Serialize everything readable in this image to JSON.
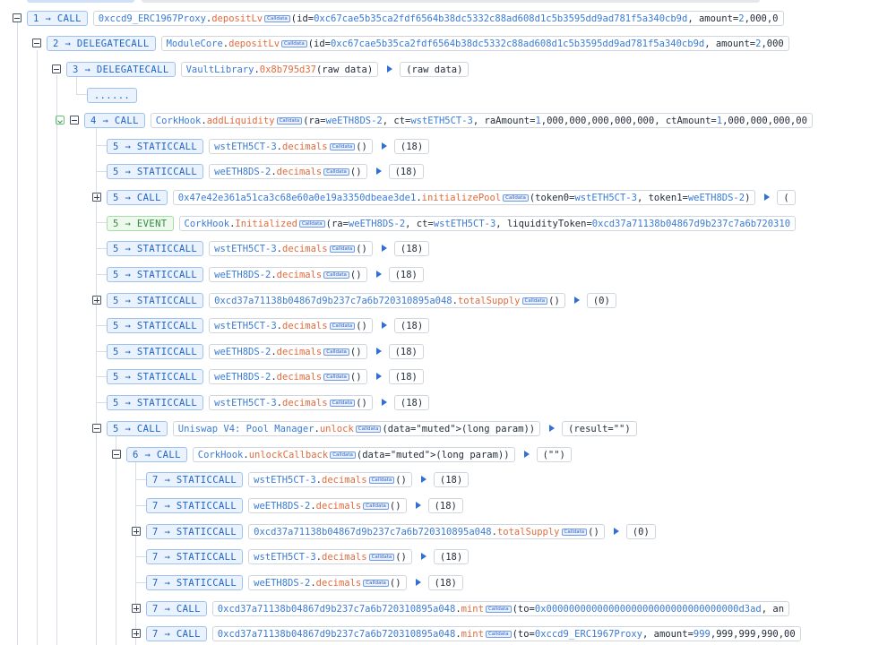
{
  "rows": [
    {
      "depth": "1",
      "type": "CALL",
      "target": "0xccd9_ERC1967Proxy",
      "fn": "depositLv",
      "badge": "Calldata",
      "args": "(id=0xc67cae5b35ca2fdf6564b38dc5332c88ad608d1c5b3595dd9ad781f5a340cb9d, amount=2,000,0",
      "result": ""
    },
    {
      "depth": "2",
      "type": "DELEGATECALL",
      "target": "ModuleCore",
      "fn": "depositLv",
      "badge": "Calldata",
      "args": "(id=0xc67cae5b35ca2fdf6564b38dc5332c88ad608d1c5b3595dd9ad781f5a340cb9d, amount=2,000",
      "result": ""
    },
    {
      "depth": "3",
      "type": "DELEGATECALL",
      "target": "VaultLibrary",
      "fn": "0x8b795d37",
      "badge": "",
      "args": "(raw data)",
      "result": "(raw data)"
    },
    {
      "depth": "",
      "type": "......",
      "target": "",
      "fn": "",
      "badge": "",
      "args": "",
      "result": ""
    },
    {
      "depth": "4",
      "type": "CALL",
      "target": "CorkHook",
      "fn": "addLiquidity",
      "badge": "Calldata",
      "args": "(ra=weETH8DS-2, ct=wstETH5CT-3, raAmount=1,000,000,000,000,000, ctAmount=1,000,000,000,00",
      "result": ""
    },
    {
      "depth": "5",
      "type": "STATICCALL",
      "target": "wstETH5CT-3",
      "fn": "decimals",
      "badge": "Calldata",
      "args": "()",
      "result": "(18)"
    },
    {
      "depth": "5",
      "type": "STATICCALL",
      "target": "weETH8DS-2",
      "fn": "decimals",
      "badge": "Calldata",
      "args": "()",
      "result": "(18)"
    },
    {
      "depth": "5",
      "type": "CALL",
      "target": "0x47e42e361a51ca3c68e60a0e19a3350dbeae3de1",
      "fn": "initializePool",
      "badge": "Calldata",
      "args": "(token0=wstETH5CT-3, token1=weETH8DS-2)",
      "result": "("
    },
    {
      "depth": "5",
      "type": "EVENT",
      "target": "CorkHook",
      "fn": "Initialized",
      "badge": "Calldata",
      "args": "(ra=weETH8DS-2, ct=wstETH5CT-3, liquidityToken=0xcd37a71138b04867d9b237c7a6b720310",
      "result": ""
    },
    {
      "depth": "5",
      "type": "STATICCALL",
      "target": "wstETH5CT-3",
      "fn": "decimals",
      "badge": "Calldata",
      "args": "()",
      "result": "(18)"
    },
    {
      "depth": "5",
      "type": "STATICCALL",
      "target": "weETH8DS-2",
      "fn": "decimals",
      "badge": "Calldata",
      "args": "()",
      "result": "(18)"
    },
    {
      "depth": "5",
      "type": "STATICCALL",
      "target": "0xcd37a71138b04867d9b237c7a6b720310895a048",
      "fn": "totalSupply",
      "badge": "Calldata",
      "args": "()",
      "result": "(0)"
    },
    {
      "depth": "5",
      "type": "STATICCALL",
      "target": "wstETH5CT-3",
      "fn": "decimals",
      "badge": "Calldata",
      "args": "()",
      "result": "(18)"
    },
    {
      "depth": "5",
      "type": "STATICCALL",
      "target": "weETH8DS-2",
      "fn": "decimals",
      "badge": "Calldata",
      "args": "()",
      "result": "(18)"
    },
    {
      "depth": "5",
      "type": "STATICCALL",
      "target": "weETH8DS-2",
      "fn": "decimals",
      "badge": "Calldata",
      "args": "()",
      "result": "(18)"
    },
    {
      "depth": "5",
      "type": "STATICCALL",
      "target": "wstETH5CT-3",
      "fn": "decimals",
      "badge": "Calldata",
      "args": "()",
      "result": "(18)"
    },
    {
      "depth": "5",
      "type": "CALL",
      "target": "Uniswap V4: Pool Manager",
      "fn": "unlock",
      "badge": "Calldata",
      "args": "(data=(long param))",
      "result": "(result=\"\")"
    },
    {
      "depth": "6",
      "type": "CALL",
      "target": "CorkHook",
      "fn": "unlockCallback",
      "badge": "Calldata",
      "args": "(data=(long param))",
      "result": "(\"\")"
    },
    {
      "depth": "7",
      "type": "STATICCALL",
      "target": "wstETH5CT-3",
      "fn": "decimals",
      "badge": "Calldata",
      "args": "()",
      "result": "(18)"
    },
    {
      "depth": "7",
      "type": "STATICCALL",
      "target": "weETH8DS-2",
      "fn": "decimals",
      "badge": "Calldata",
      "args": "()",
      "result": "(18)"
    },
    {
      "depth": "7",
      "type": "STATICCALL",
      "target": "0xcd37a71138b04867d9b237c7a6b720310895a048",
      "fn": "totalSupply",
      "badge": "Calldata",
      "args": "()",
      "result": "(0)"
    },
    {
      "depth": "7",
      "type": "STATICCALL",
      "target": "wstETH5CT-3",
      "fn": "decimals",
      "badge": "Calldata",
      "args": "()",
      "result": "(18)"
    },
    {
      "depth": "7",
      "type": "STATICCALL",
      "target": "weETH8DS-2",
      "fn": "decimals",
      "badge": "Calldata",
      "args": "()",
      "result": "(18)"
    },
    {
      "depth": "7",
      "type": "CALL",
      "target": "0xcd37a71138b04867d9b237c7a6b720310895a048",
      "fn": "mint",
      "badge": "Calldata",
      "args": "(to=0x0000000000000000000000000000000000d3ad, an",
      "result": ""
    },
    {
      "depth": "7",
      "type": "CALL",
      "target": "0xcd37a71138b04867d9b237c7a6b720310895a048",
      "fn": "mint",
      "badge": "Calldata",
      "args": "(to=0xccd9_ERC1967Proxy, amount=999,999,999,990,00",
      "result": ""
    }
  ]
}
